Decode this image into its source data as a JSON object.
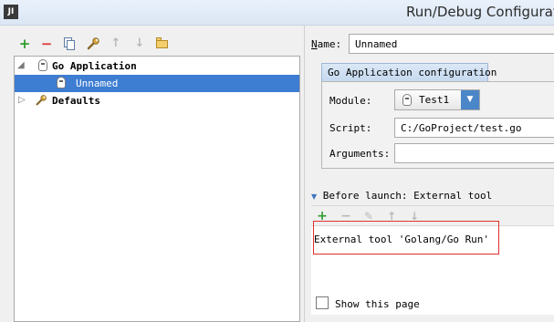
{
  "window": {
    "app_icon_text": "JI",
    "title": "Run/Debug Configurat"
  },
  "toolbar": {
    "add_glyph": "+",
    "remove_glyph": "−",
    "up_glyph": "↑",
    "down_glyph": "↓"
  },
  "tree": {
    "items": [
      {
        "label": "Go Application",
        "expanded": true,
        "icon": "go-gopher-icon"
      },
      {
        "label": "Unnamed",
        "selected": true,
        "icon": "go-gopher-icon"
      },
      {
        "label": "Defaults",
        "expanded": false,
        "icon": "wrench-icon"
      }
    ]
  },
  "form": {
    "name_label_prefix": "N",
    "name_label_rest": "ame:",
    "name_value": "Unnamed",
    "config_tab": "Go Application configuration",
    "module_label": "Module:",
    "module_value": "Test1",
    "script_label": "Script:",
    "script_value": "C:/GoProject/test.go",
    "arguments_label": "Arguments:",
    "arguments_value": ""
  },
  "before_launch": {
    "header": "Before launch: External tool",
    "add_glyph": "+",
    "remove_glyph": "−",
    "edit_glyph": "✎",
    "up_glyph": "↑",
    "down_glyph": "↓",
    "items": [
      "External tool 'Golang/Go Run'"
    ]
  },
  "footer": {
    "show_page_label": "Show this page",
    "show_page_checked": false
  },
  "colors": {
    "selection": "#3d7dd2",
    "highlight_box": "#e0302c",
    "add_green": "#2e9a2e",
    "remove_red": "#dd3333"
  }
}
